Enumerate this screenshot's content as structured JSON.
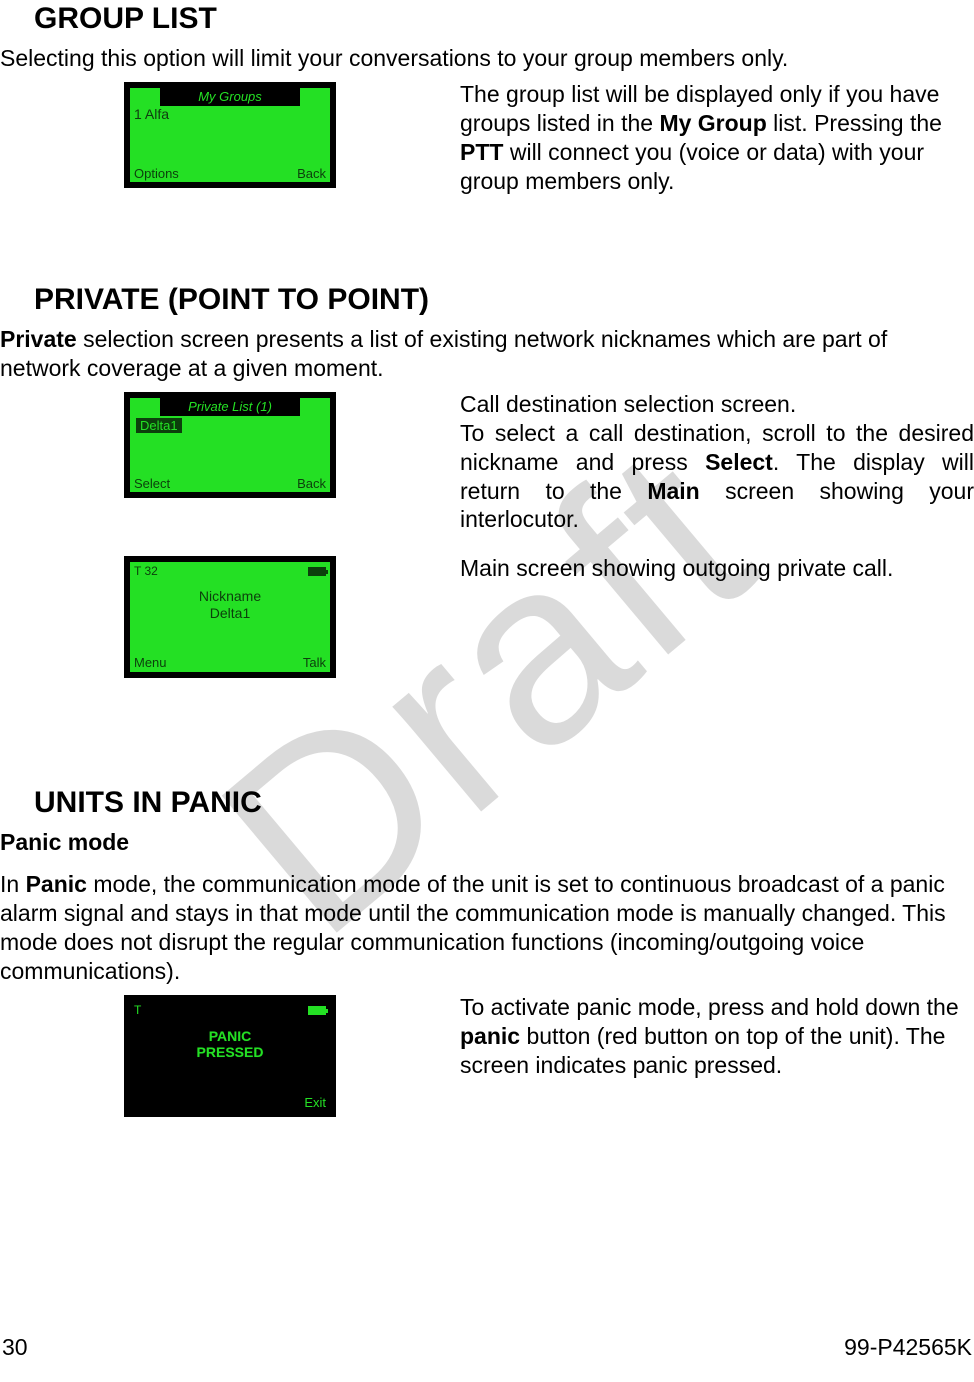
{
  "watermark": "Draft",
  "section1": {
    "heading": "GROUP LIST",
    "intro": "Selecting this option will limit your conversations to your group members only.",
    "screen": {
      "title": "My Groups",
      "item": "1 Alfa",
      "left": "Options",
      "right": "Back"
    },
    "para_a": "The group list will be displayed only if you have groups listed in the ",
    "bold_a": "My Group",
    "para_b": " list. Pressing the ",
    "bold_b": "PTT",
    "para_c": " will connect you (voice or data) with your group members only."
  },
  "section2": {
    "heading": "PRIVATE (POINT TO POINT)",
    "intro_bold": "Private",
    "intro_rest": " selection screen presents a list of existing network nicknames which are part of network coverage at a given moment.",
    "screen1": {
      "title": "Private List    (1)",
      "item": "Delta1",
      "left": "Select",
      "right": "Back"
    },
    "para1_a": "Call destination selection screen.",
    "para1_b": "To select a call destination, scroll to the desired nickname and press ",
    "para1_bold1": "Select",
    "para1_c": ". The display will return to the ",
    "para1_bold2": "Main",
    "para1_d": " screen showing your interlocutor.",
    "screen2": {
      "tl": "T    32",
      "line1": "Nickname",
      "line2": "Delta1",
      "left": "Menu",
      "right": "Talk"
    },
    "para2": "Main screen showing outgoing private call."
  },
  "section3": {
    "heading": "UNITS IN PANIC",
    "subhead": "Panic mode",
    "intro_a": "In ",
    "intro_bold": "Panic",
    "intro_b": " mode, the communication mode of the unit is set to continuous broadcast of a panic alarm signal and stays in that mode until the communication mode is manually changed. This mode does not disrupt the regular communication functions (incoming/outgoing voice communications).",
    "screen": {
      "tl": "T",
      "line1": "PANIC",
      "line2": "PRESSED",
      "right": "Exit"
    },
    "para_a": "To activate panic  mode, press and hold down the ",
    "para_bold": "panic",
    "para_b": " button (red button on top of the unit). The screen indicates panic pressed."
  },
  "footer": {
    "page": "30",
    "doc": "99-P42565K"
  }
}
